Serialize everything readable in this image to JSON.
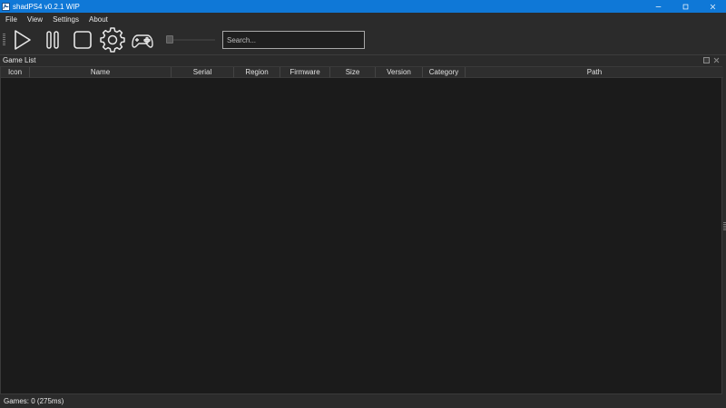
{
  "window": {
    "title": "shadPS4 v0.2.1 WIP",
    "title_bar_color": "#0f78d7",
    "controls": [
      "minimize-icon",
      "maximize-icon",
      "close-icon"
    ]
  },
  "menu": {
    "items": [
      {
        "label": "File"
      },
      {
        "label": "View"
      },
      {
        "label": "Settings"
      },
      {
        "label": "About"
      }
    ]
  },
  "toolbar": {
    "buttons": [
      {
        "icon": "play-icon"
      },
      {
        "icon": "pause-icon"
      },
      {
        "icon": "stop-icon"
      },
      {
        "icon": "gear-icon"
      },
      {
        "icon": "gamepad-icon"
      }
    ],
    "icon_size_slider": {
      "value": 0.0
    },
    "search": {
      "placeholder": "Search...",
      "value": ""
    }
  },
  "game_list": {
    "dock_title": "Game List",
    "columns": [
      {
        "label": "Icon"
      },
      {
        "label": "Name"
      },
      {
        "label": "Serial"
      },
      {
        "label": "Region"
      },
      {
        "label": "Firmware"
      },
      {
        "label": "Size"
      },
      {
        "label": "Version"
      },
      {
        "label": "Category"
      },
      {
        "label": "Path"
      }
    ],
    "rows": []
  },
  "status": {
    "text": "Games: 0 (275ms)"
  },
  "colors": {
    "background": "#2b2b2b",
    "table_background": "#1b1b1b",
    "accent": "#0f78d7"
  }
}
